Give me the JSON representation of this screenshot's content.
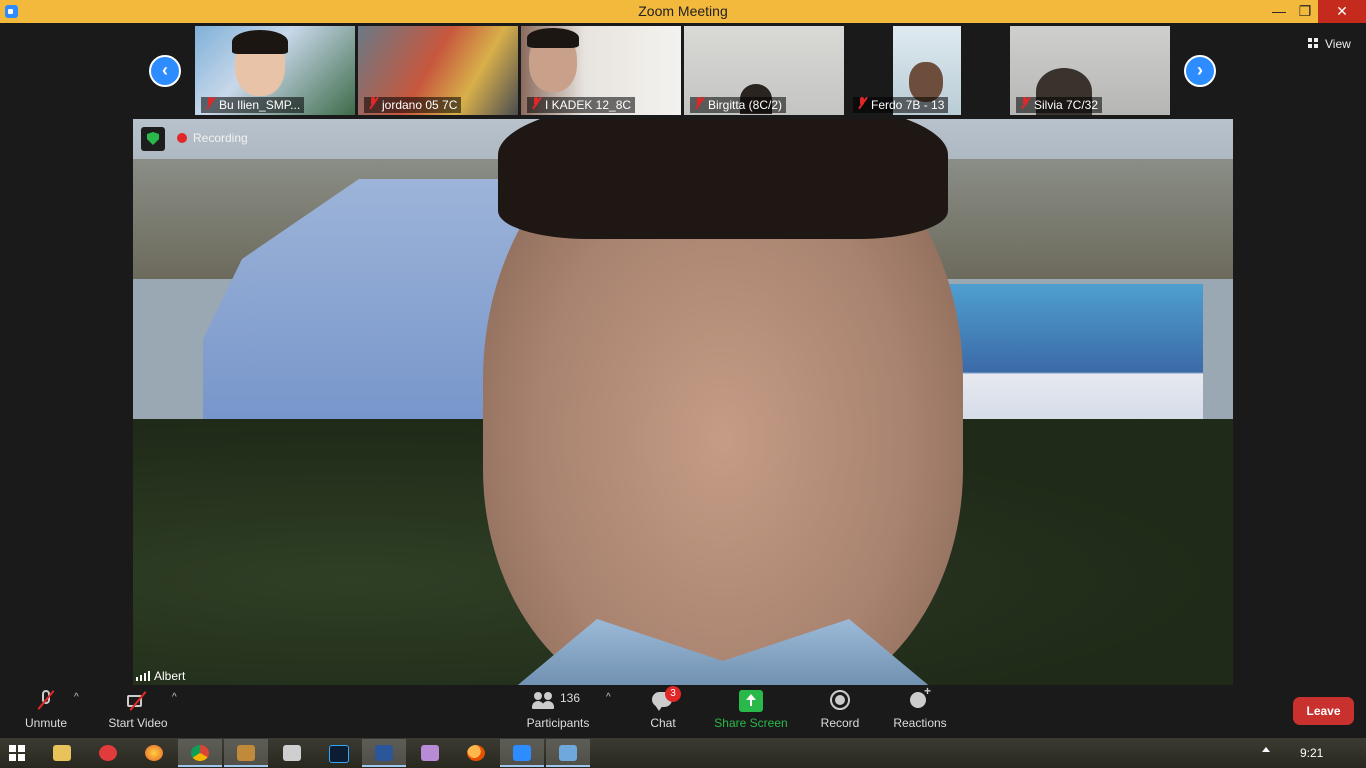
{
  "window": {
    "title": "Zoom Meeting"
  },
  "gallery": {
    "participants": [
      {
        "name": "Bu Ilien_SMP...",
        "muted": true
      },
      {
        "name": "jordano 05 7C",
        "muted": true
      },
      {
        "name": "I KADEK 12_8C",
        "muted": true
      },
      {
        "name": "Birgitta (8C/2)",
        "muted": true
      },
      {
        "name": "Ferdo 7B - 13",
        "muted": true
      },
      {
        "name": "Silvia 7C/32",
        "muted": true
      }
    ],
    "prev_arrow": "‹",
    "next_arrow": "›",
    "view_label": "View"
  },
  "main": {
    "recording_label": "Recording",
    "speaker_name": "Albert"
  },
  "toolbar": {
    "unmute_label": "Unmute",
    "start_video_label": "Start Video",
    "participants_label": "Participants",
    "participants_count": "136",
    "chat_label": "Chat",
    "chat_badge": "3",
    "share_label": "Share Screen",
    "record_label": "Record",
    "reactions_label": "Reactions",
    "leave_label": "Leave",
    "caret": "^"
  },
  "taskbar": {
    "time": "9:21",
    "apps": [
      "file-explorer",
      "screen-recorder",
      "firefox",
      "chrome",
      "image-viewer",
      "video-editor",
      "photoshop",
      "word",
      "winrar",
      "search",
      "zoom",
      "remote-desktop"
    ]
  },
  "colors": {
    "titlebar": "#f3b93d",
    "accent": "#2d8cff",
    "share_green": "#29b94a",
    "leave_red": "#c9312f",
    "muted_red": "#e02828"
  }
}
